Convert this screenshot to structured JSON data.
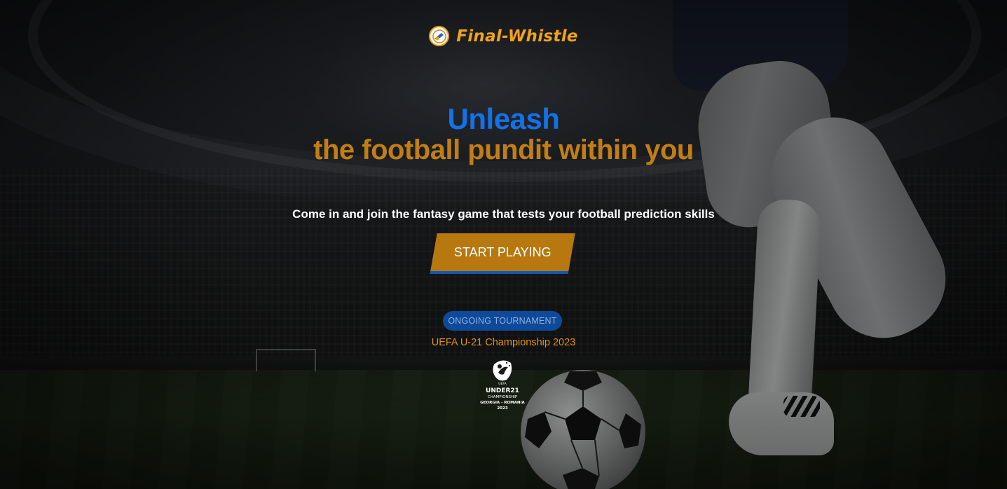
{
  "brand": {
    "name": "Final-Whistle",
    "logo_icon": "whistle-ball-icon",
    "color": "#f0a31b"
  },
  "hero": {
    "headline_line1": "Unleash",
    "headline_line2": "the football pundit within you",
    "headline_line1_color": "#1471e8",
    "headline_line2_color": "#c27e14",
    "subtitle": "Come in and join the fantasy game that tests your football prediction skills",
    "cta_label": "START PLAYING",
    "cta_color": "#b7780f"
  },
  "tournament": {
    "badge": "ONGOING TOURNAMENT",
    "name": "UEFA U-21 Championship 2023",
    "logo": {
      "icon": "uefa-under21-logo",
      "top_text": "UEFA",
      "line1": "UNDER21",
      "line2": "CHAMPIONSHIP",
      "line3": "GEORGIA - ROMANIA",
      "line4": "2023"
    }
  }
}
